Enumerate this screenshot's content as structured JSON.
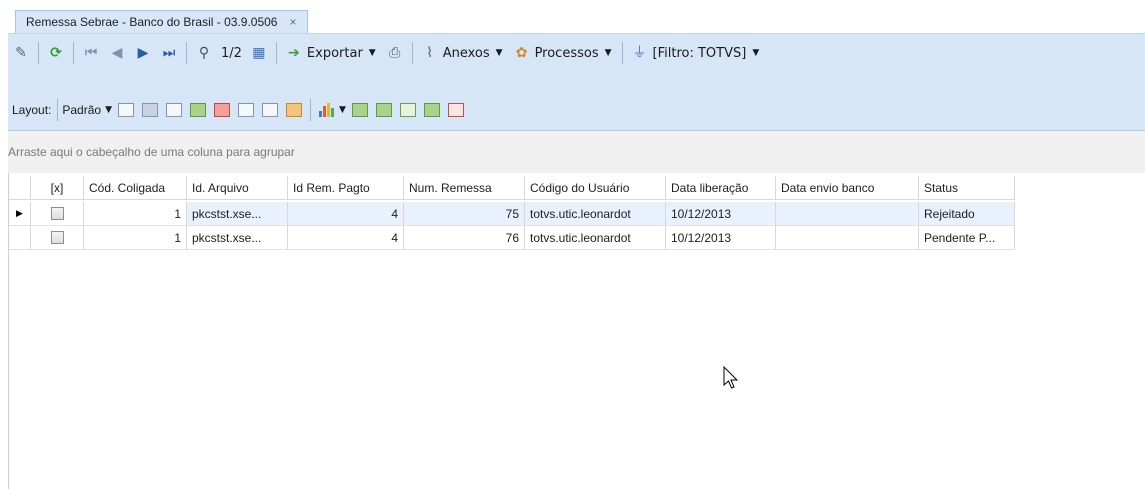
{
  "tab": {
    "title": "Remessa Sebrae - Banco do Brasil - 03.9.0506",
    "close": "×"
  },
  "toolbar1": {
    "pager": "1/2",
    "exportar": "Exportar",
    "anexos": "Anexos",
    "processos": "Processos",
    "filtro": "[Filtro: TOTVS]"
  },
  "toolbar2": {
    "layout_label": "Layout:",
    "layout_value": "Padrão"
  },
  "group_panel": {
    "hint": "Arraste aqui o cabeçalho de uma coluna para agrupar"
  },
  "grid": {
    "columns": [
      "[x]",
      "Cód. Coligada",
      "Id. Arquivo",
      "Id Rem. Pagto",
      "Num. Remessa",
      "Código do Usuário",
      "Data liberação",
      "Data envio banco",
      "Status"
    ],
    "rows": [
      {
        "coligada": "1",
        "arquivo": "pkcstst.xse...",
        "rem_pagto": "4",
        "num_remessa": "75",
        "usuario": "totvs.utic.leonardot",
        "data_liberacao": "10/12/2013",
        "data_envio": "",
        "status": "Rejeitado"
      },
      {
        "coligada": "1",
        "arquivo": "pkcstst.xse...",
        "rem_pagto": "4",
        "num_remessa": "76",
        "usuario": "totvs.utic.leonardot",
        "data_liberacao": "10/12/2013",
        "data_envio": "",
        "status": "Pendente P..."
      }
    ]
  },
  "colors": {
    "toolbar_bg": "#d6e6f7",
    "tab_bg": "#d7e6f8",
    "selection": "#e8f1fc"
  }
}
